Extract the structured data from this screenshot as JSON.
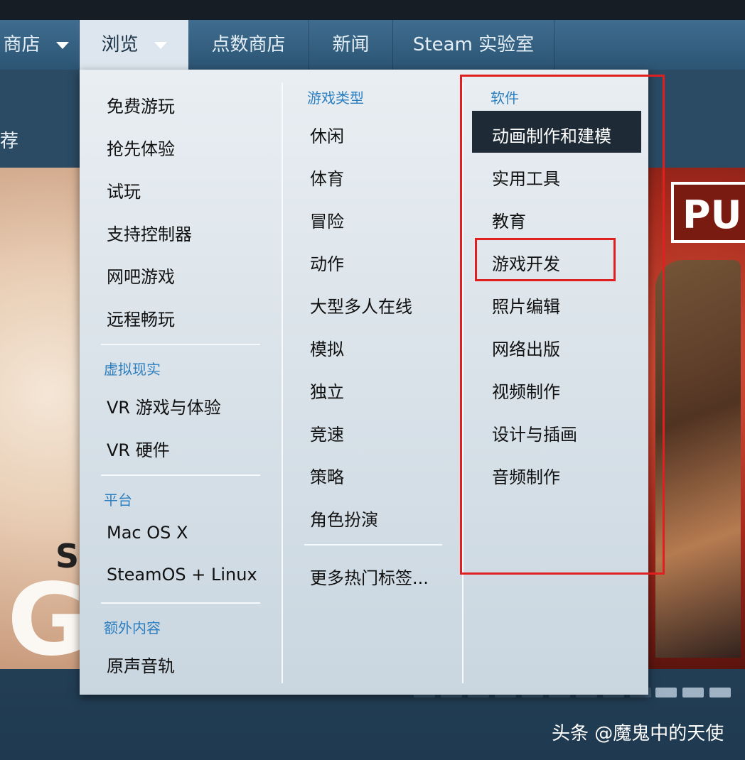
{
  "nav": {
    "store_label": "商店",
    "browse_label": "浏览",
    "points_label": "点数商店",
    "news_label": "新闻",
    "labs_label": "Steam 实验室"
  },
  "subbar": {
    "partial_text": "荐"
  },
  "banner": {
    "left_letters_top": "SU",
    "left_letters_big": "GI",
    "right_logo": "PUBG"
  },
  "menu": {
    "col1": {
      "items": [
        "免费游玩",
        "抢先体验",
        "试玩",
        "支持控制器",
        "网吧游戏",
        "远程畅玩"
      ],
      "vr_head": "虚拟现实",
      "vr_items": [
        "VR 游戏与体验",
        "VR 硬件"
      ],
      "platform_head": "平台",
      "platform_items": [
        "Mac OS X",
        "SteamOS + Linux"
      ],
      "extra_head": "额外内容",
      "extra_items": [
        "原声音轨"
      ]
    },
    "col2": {
      "head": "游戏类型",
      "items": [
        "休闲",
        "体育",
        "冒险",
        "动作",
        "大型多人在线",
        "模拟",
        "独立",
        "竞速",
        "策略",
        "角色扮演"
      ],
      "more": "更多热门标签..."
    },
    "col3": {
      "head": "软件",
      "items": [
        "动画制作和建模",
        "实用工具",
        "教育",
        "游戏开发",
        "照片编辑",
        "网络出版",
        "视频制作",
        "设计与插画",
        "音频制作"
      ]
    }
  },
  "watermark": "头条 @魔鬼中的天使",
  "colors": {
    "highlight_red": "#e02020",
    "menu_head_blue": "#2e7fbf"
  }
}
